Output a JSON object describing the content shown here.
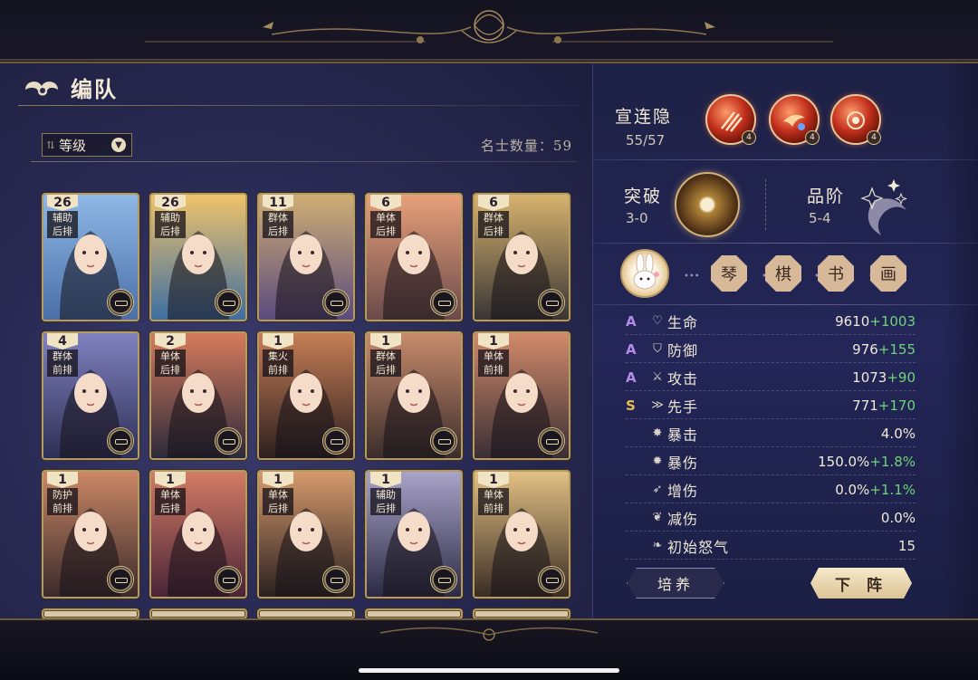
{
  "header": {
    "title": "编队",
    "title_icon": "cloud-swirl-icon"
  },
  "toolbar": {
    "sort_label": "等级",
    "count_label": "名士数量：",
    "count_value": "59"
  },
  "cards": [
    {
      "level": "26",
      "role1": "辅助",
      "role2": "后排",
      "colors": [
        "#8fb8e6",
        "#4a6fa8"
      ]
    },
    {
      "level": "26",
      "role1": "辅助",
      "role2": "后排",
      "colors": [
        "#f0c36a",
        "#3d6ea2"
      ]
    },
    {
      "level": "11",
      "role1": "群体",
      "role2": "后排",
      "colors": [
        "#cfae74",
        "#5b4a7e"
      ]
    },
    {
      "level": "6",
      "role1": "单体",
      "role2": "后排",
      "colors": [
        "#e8a07a",
        "#6a4a4a"
      ]
    },
    {
      "level": "6",
      "role1": "群体",
      "role2": "后排",
      "colors": [
        "#d7b36e",
        "#3a3535"
      ]
    },
    {
      "level": "4",
      "role1": "群体",
      "role2": "前排",
      "colors": [
        "#7f82bf",
        "#2e2f55"
      ]
    },
    {
      "level": "2",
      "role1": "单体",
      "role2": "后排",
      "colors": [
        "#d67b5c",
        "#2c2a3a"
      ]
    },
    {
      "level": "1",
      "role1": "集火",
      "role2": "前排",
      "colors": [
        "#c67e55",
        "#2c1f1f"
      ]
    },
    {
      "level": "1",
      "role1": "群体",
      "role2": "后排",
      "colors": [
        "#c88b6c",
        "#3b2d2b"
      ]
    },
    {
      "level": "1",
      "role1": "单体",
      "role2": "前排",
      "colors": [
        "#d28a6a",
        "#3a2e34"
      ]
    },
    {
      "level": "1",
      "role1": "防护",
      "role2": "前排",
      "colors": [
        "#cb8766",
        "#3a2a2a"
      ]
    },
    {
      "level": "1",
      "role1": "单体",
      "role2": "后排",
      "colors": [
        "#d47c64",
        "#4a2438"
      ]
    },
    {
      "level": "1",
      "role1": "单体",
      "role2": "后排",
      "colors": [
        "#d69a6c",
        "#2a2020"
      ]
    },
    {
      "level": "1",
      "role1": "辅助",
      "role2": "后排",
      "colors": [
        "#a9a3c8",
        "#2b2a44"
      ]
    },
    {
      "level": "1",
      "role1": "单体",
      "role2": "前排",
      "colors": [
        "#e3c184",
        "#3a2c24"
      ]
    }
  ],
  "hero": {
    "name": "宣连隐",
    "fragments": "55/57",
    "skills": [
      {
        "badge": "4"
      },
      {
        "badge": "4"
      },
      {
        "badge": "4"
      }
    ],
    "breakthrough_label": "突破",
    "breakthrough_value": "3-0",
    "rank_label": "品阶",
    "rank_value": "5-4",
    "arts": [
      "琴",
      "棋",
      "书",
      "画"
    ],
    "stats": [
      {
        "grade": "A",
        "grade_color": "#b28ae8",
        "icon": "heart-icon",
        "glyph": "♡",
        "name": "生命",
        "value": "9610",
        "bonus": "+1003"
      },
      {
        "grade": "A",
        "grade_color": "#b28ae8",
        "icon": "shield-icon",
        "glyph": "⛉",
        "name": "防御",
        "value": "976",
        "bonus": "+155"
      },
      {
        "grade": "A",
        "grade_color": "#b28ae8",
        "icon": "sword-icon",
        "glyph": "⚔",
        "name": "攻击",
        "value": "1073",
        "bonus": "+90"
      },
      {
        "grade": "S",
        "grade_color": "#e6c04f",
        "icon": "speed-icon",
        "glyph": "≫",
        "name": "先手",
        "value": "771",
        "bonus": "+170"
      },
      {
        "grade": "",
        "grade_color": "#ffffff",
        "icon": "crit-icon",
        "glyph": "✸",
        "name": "暴击",
        "value": "4.0%",
        "bonus": ""
      },
      {
        "grade": "",
        "grade_color": "#ffffff",
        "icon": "crit-damage-icon",
        "glyph": "✹",
        "name": "暴伤",
        "value": "150.0%",
        "bonus": "+1.8%"
      },
      {
        "grade": "",
        "grade_color": "#ffffff",
        "icon": "damage-up-icon",
        "glyph": "➶",
        "name": "增伤",
        "value": "0.0%",
        "bonus": "+1.1%"
      },
      {
        "grade": "",
        "grade_color": "#ffffff",
        "icon": "damage-reduce-icon",
        "glyph": "❦",
        "name": "减伤",
        "value": "0.0%",
        "bonus": ""
      },
      {
        "grade": "",
        "grade_color": "#ffffff",
        "icon": "rage-drop-icon",
        "glyph": "❧",
        "name": "初始怒气",
        "value": "15",
        "bonus": ""
      }
    ]
  },
  "actions": {
    "train_label": "培养",
    "remove_label": "下 阵"
  }
}
